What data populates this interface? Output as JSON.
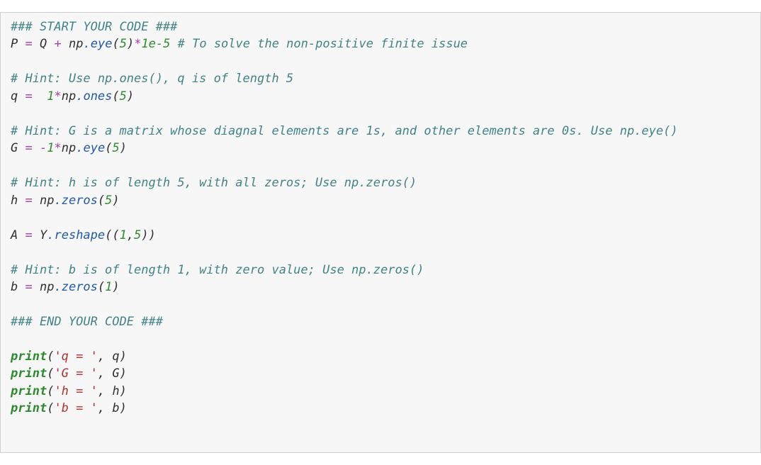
{
  "code": {
    "lines": [
      {
        "type": "comment",
        "text": "### START YOUR CODE ###"
      },
      {
        "type": "stmt",
        "tokens": [
          {
            "c": "var",
            "t": "P"
          },
          {
            "c": "sp",
            "t": " "
          },
          {
            "c": "op",
            "t": "="
          },
          {
            "c": "sp",
            "t": " "
          },
          {
            "c": "var",
            "t": "Q"
          },
          {
            "c": "sp",
            "t": " "
          },
          {
            "c": "op",
            "t": "+"
          },
          {
            "c": "sp",
            "t": " "
          },
          {
            "c": "var",
            "t": "np"
          },
          {
            "c": "attr",
            "t": ".eye"
          },
          {
            "c": "par",
            "t": "("
          },
          {
            "c": "num",
            "t": "5"
          },
          {
            "c": "par",
            "t": ")"
          },
          {
            "c": "op",
            "t": "*"
          },
          {
            "c": "num",
            "t": "1e-5"
          },
          {
            "c": "sp",
            "t": " "
          },
          {
            "c": "cm",
            "t": "# To solve the non-positive finite issue"
          }
        ]
      },
      {
        "type": "blank"
      },
      {
        "type": "comment",
        "text": "# Hint: Use np.ones(), q is of length 5"
      },
      {
        "type": "stmt",
        "tokens": [
          {
            "c": "var",
            "t": "q"
          },
          {
            "c": "sp",
            "t": " "
          },
          {
            "c": "op",
            "t": "="
          },
          {
            "c": "sp",
            "t": "  "
          },
          {
            "c": "num",
            "t": "1"
          },
          {
            "c": "op",
            "t": "*"
          },
          {
            "c": "var",
            "t": "np"
          },
          {
            "c": "attr",
            "t": ".ones"
          },
          {
            "c": "par",
            "t": "("
          },
          {
            "c": "num",
            "t": "5"
          },
          {
            "c": "par",
            "t": ")"
          }
        ]
      },
      {
        "type": "blank"
      },
      {
        "type": "comment",
        "text": "# Hint: G is a matrix whose diagnal elements are 1s, and other elements are 0s. Use np.eye()"
      },
      {
        "type": "stmt",
        "tokens": [
          {
            "c": "var",
            "t": "G"
          },
          {
            "c": "sp",
            "t": " "
          },
          {
            "c": "op",
            "t": "="
          },
          {
            "c": "sp",
            "t": " "
          },
          {
            "c": "op",
            "t": "-"
          },
          {
            "c": "num",
            "t": "1"
          },
          {
            "c": "op",
            "t": "*"
          },
          {
            "c": "var",
            "t": "np"
          },
          {
            "c": "attr",
            "t": ".eye"
          },
          {
            "c": "par",
            "t": "("
          },
          {
            "c": "num",
            "t": "5"
          },
          {
            "c": "par",
            "t": ")"
          }
        ]
      },
      {
        "type": "blank"
      },
      {
        "type": "comment",
        "text": "# Hint: h is of length 5, with all zeros; Use np.zeros()"
      },
      {
        "type": "stmt",
        "tokens": [
          {
            "c": "var",
            "t": "h"
          },
          {
            "c": "sp",
            "t": " "
          },
          {
            "c": "op",
            "t": "="
          },
          {
            "c": "sp",
            "t": " "
          },
          {
            "c": "var",
            "t": "np"
          },
          {
            "c": "attr",
            "t": ".zeros"
          },
          {
            "c": "par",
            "t": "("
          },
          {
            "c": "num",
            "t": "5"
          },
          {
            "c": "par",
            "t": ")"
          }
        ]
      },
      {
        "type": "blank"
      },
      {
        "type": "stmt",
        "tokens": [
          {
            "c": "var",
            "t": "A"
          },
          {
            "c": "sp",
            "t": " "
          },
          {
            "c": "op",
            "t": "="
          },
          {
            "c": "sp",
            "t": " "
          },
          {
            "c": "var",
            "t": "Y"
          },
          {
            "c": "attr",
            "t": ".reshape"
          },
          {
            "c": "par",
            "t": "(("
          },
          {
            "c": "num",
            "t": "1"
          },
          {
            "c": "par",
            "t": ","
          },
          {
            "c": "num",
            "t": "5"
          },
          {
            "c": "par",
            "t": "))"
          }
        ]
      },
      {
        "type": "blank"
      },
      {
        "type": "comment",
        "text": "# Hint: b is of length 1, with zero value; Use np.zeros()"
      },
      {
        "type": "stmt",
        "tokens": [
          {
            "c": "var",
            "t": "b"
          },
          {
            "c": "sp",
            "t": " "
          },
          {
            "c": "op",
            "t": "="
          },
          {
            "c": "sp",
            "t": " "
          },
          {
            "c": "var",
            "t": "np"
          },
          {
            "c": "attr",
            "t": ".zeros"
          },
          {
            "c": "par",
            "t": "("
          },
          {
            "c": "num",
            "t": "1"
          },
          {
            "c": "par",
            "t": ")"
          }
        ]
      },
      {
        "type": "blank"
      },
      {
        "type": "comment",
        "text": "### END YOUR CODE ###"
      },
      {
        "type": "blank"
      },
      {
        "type": "stmt",
        "tokens": [
          {
            "c": "kw",
            "t": "print"
          },
          {
            "c": "par",
            "t": "("
          },
          {
            "c": "str",
            "t": "'q = '"
          },
          {
            "c": "par",
            "t": ", "
          },
          {
            "c": "var",
            "t": "q"
          },
          {
            "c": "par",
            "t": ")"
          }
        ]
      },
      {
        "type": "stmt",
        "tokens": [
          {
            "c": "kw",
            "t": "print"
          },
          {
            "c": "par",
            "t": "("
          },
          {
            "c": "str",
            "t": "'G = '"
          },
          {
            "c": "par",
            "t": ", "
          },
          {
            "c": "var",
            "t": "G"
          },
          {
            "c": "par",
            "t": ")"
          }
        ]
      },
      {
        "type": "stmt",
        "tokens": [
          {
            "c": "kw",
            "t": "print"
          },
          {
            "c": "par",
            "t": "("
          },
          {
            "c": "str",
            "t": "'h = '"
          },
          {
            "c": "par",
            "t": ", "
          },
          {
            "c": "var",
            "t": "h"
          },
          {
            "c": "par",
            "t": ")"
          }
        ]
      },
      {
        "type": "stmt",
        "tokens": [
          {
            "c": "kw",
            "t": "print"
          },
          {
            "c": "par",
            "t": "("
          },
          {
            "c": "str",
            "t": "'b = '"
          },
          {
            "c": "par",
            "t": ", "
          },
          {
            "c": "var",
            "t": "b"
          },
          {
            "c": "par",
            "t": ")"
          }
        ]
      }
    ]
  }
}
